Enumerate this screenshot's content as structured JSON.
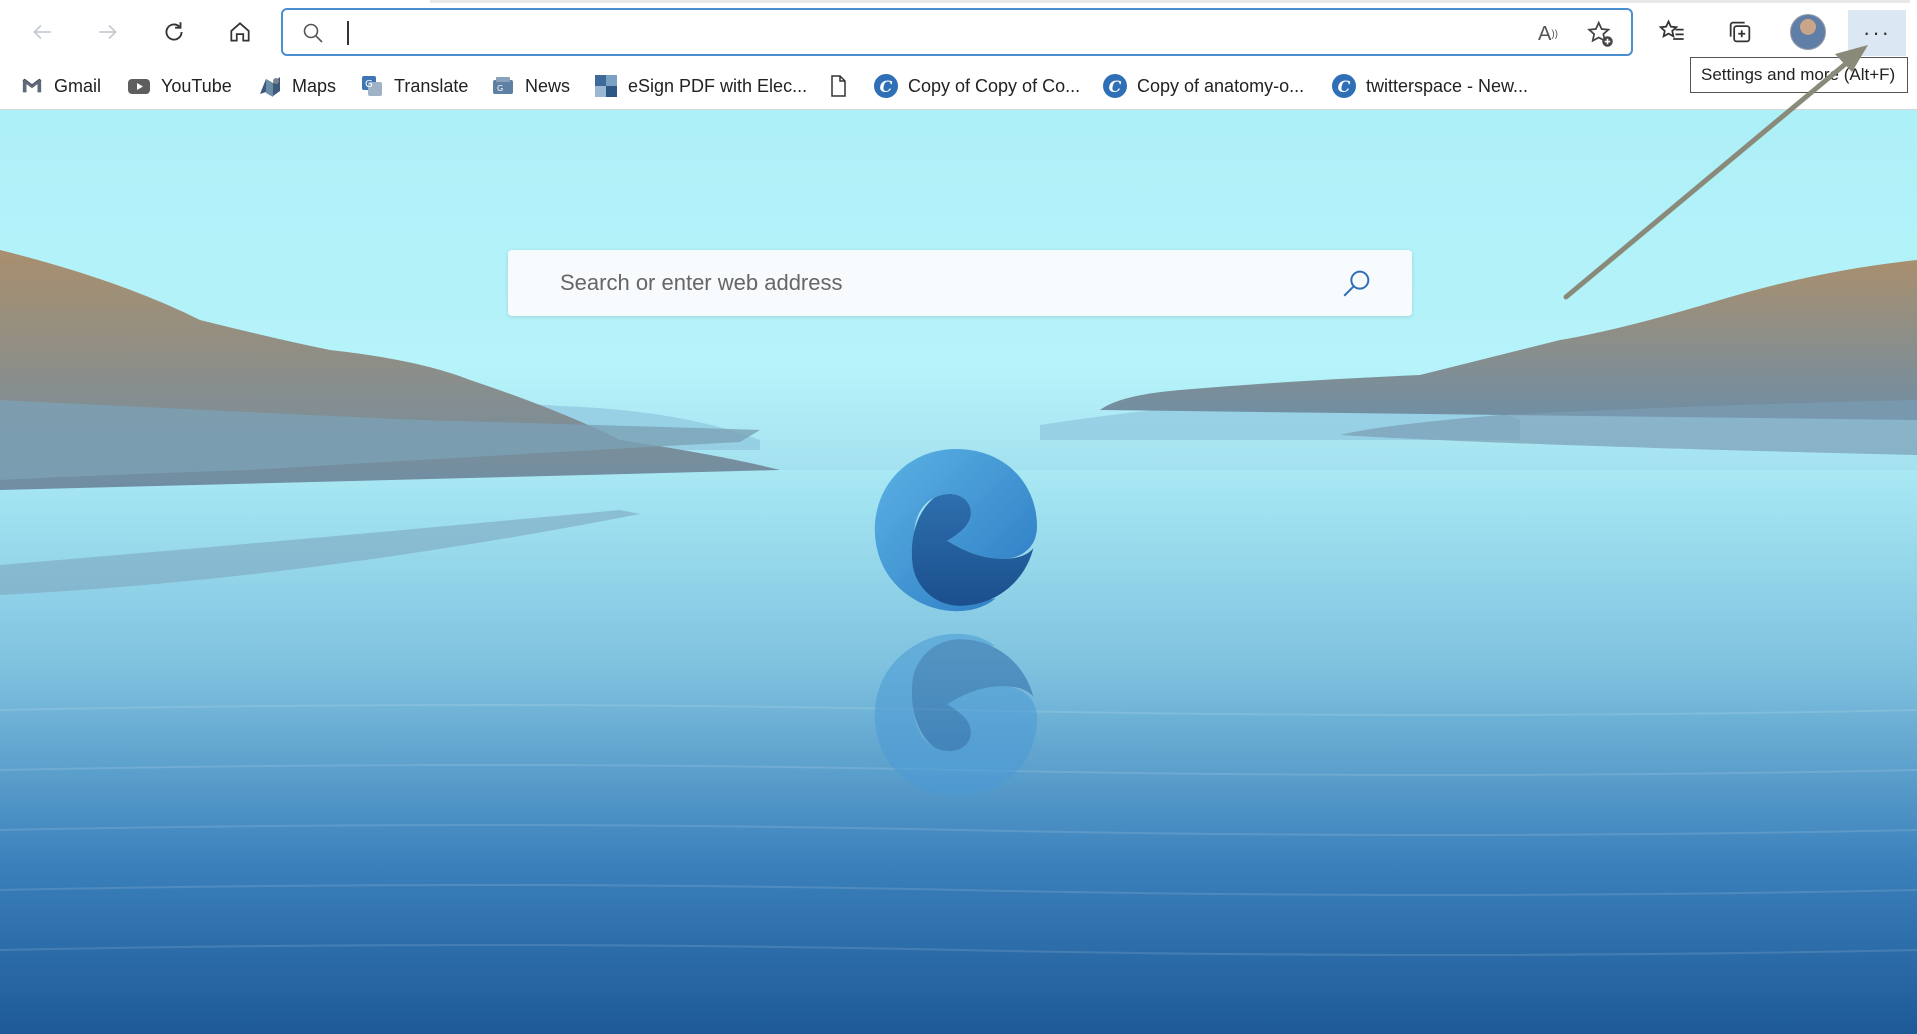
{
  "toolbar": {
    "back_icon": "arrow-left-icon",
    "forward_icon": "arrow-right-icon",
    "refresh_icon": "refresh-icon",
    "home_icon": "home-icon",
    "address_value": "",
    "read_aloud_icon": "read-aloud-icon",
    "add_favorite_icon": "star-add-icon",
    "favorites_icon": "favorites-icon",
    "collections_icon": "collections-icon",
    "menu_label": "···"
  },
  "tooltip": {
    "text": "Settings and more (Alt+F)"
  },
  "favorites_bar": {
    "items": [
      {
        "label": "Gmail",
        "icon": "gmail-icon"
      },
      {
        "label": "YouTube",
        "icon": "youtube-icon"
      },
      {
        "label": "Maps",
        "icon": "maps-icon"
      },
      {
        "label": "Translate",
        "icon": "translate-icon"
      },
      {
        "label": "News",
        "icon": "news-icon"
      },
      {
        "label": "eSign PDF with Elec...",
        "icon": "esign-icon"
      },
      {
        "label": "",
        "icon": "file-icon"
      },
      {
        "label": "Copy of Copy of Co...",
        "icon": "c-icon"
      },
      {
        "label": "Copy of anatomy-o...",
        "icon": "c-icon"
      },
      {
        "label": "twitterspace - New...",
        "icon": "c-icon"
      }
    ]
  },
  "new_tab": {
    "search_placeholder": "Search or enter web address",
    "logo": "edge-logo"
  },
  "colors": {
    "accent": "#4a90d0",
    "menu_highlight": "#dbe8f4",
    "annotation_arrow": "#8a8a7a"
  }
}
